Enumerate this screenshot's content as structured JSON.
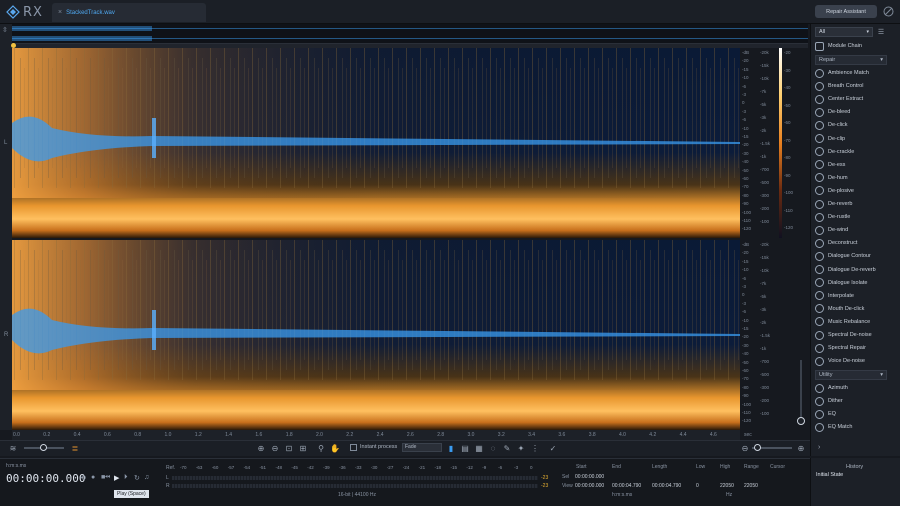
{
  "app": {
    "logo": "RX",
    "file_tab": "StackedTrack.wav",
    "repair_assistant": "Repair Assistant"
  },
  "channels": {
    "left": "L",
    "right": "R"
  },
  "spectrogram": {
    "db_scale": [
      "-dB",
      "-20",
      "-15",
      "-10",
      "-6",
      "-3",
      "0",
      "-3",
      "-6",
      "-10",
      "-15",
      "-20",
      "-30",
      "-40",
      "-50",
      "-60",
      "-70",
      "-80",
      "-90",
      "-100",
      "-110",
      "-120"
    ],
    "hz_scale": [
      "-20k",
      "-15k",
      "-10k",
      "-7k",
      "-5k",
      "-3k",
      "-2k",
      "-1.5k",
      "-1k",
      "-700",
      "-500",
      "-300",
      "-200",
      "-100"
    ],
    "colorbar": [
      "-20",
      "-30",
      "-40",
      "-50",
      "-60",
      "-70",
      "-80",
      "-90",
      "-100",
      "-110",
      "-120"
    ]
  },
  "timeline": {
    "labels": [
      "0.0",
      "0.2",
      "0.4",
      "0.6",
      "0.8",
      "1.0",
      "1.2",
      "1.4",
      "1.6",
      "1.8",
      "2.0",
      "2.2",
      "2.4",
      "2.6",
      "2.8",
      "3.0",
      "3.2",
      "3.4",
      "3.6",
      "3.8",
      "4.0",
      "4.2",
      "4.4",
      "4.6"
    ],
    "unit": "sec"
  },
  "toolbar": {
    "instant_process": "Instant process",
    "fade_mode": "Fade"
  },
  "panel": {
    "filter": "All",
    "module_chain": "Module Chain",
    "repair_section": "Repair",
    "utility_section": "Utility",
    "repair_modules": [
      "Ambience Match",
      "Breath Control",
      "Center Extract",
      "De-bleed",
      "De-click",
      "De-clip",
      "De-crackle",
      "De-ess",
      "De-hum",
      "De-plosive",
      "De-reverb",
      "De-rustle",
      "De-wind",
      "Deconstruct",
      "Dialogue Contour",
      "Dialogue De-reverb",
      "Dialogue Isolate",
      "Interpolate",
      "Mouth De-click",
      "Music Rebalance",
      "Spectral De-noise",
      "Spectral Repair",
      "Voice De-noise"
    ],
    "utility_modules": [
      "Azimuth",
      "Dither",
      "EQ",
      "EQ Match"
    ]
  },
  "transport": {
    "time_format": "h:m:s.ms",
    "time": "00:00:00.000",
    "tooltip": "Play (Space)",
    "meter_ref": "Ref.",
    "meter_scale": [
      "-70",
      "-63",
      "-60",
      "-57",
      "-54",
      "-51",
      "-48",
      "-45",
      "-42",
      "-39",
      "-36",
      "-33",
      "-30",
      "-27",
      "-24",
      "-21",
      "-18",
      "-15",
      "-12",
      "-9",
      "-6",
      "-3",
      "0"
    ],
    "meter_l": "L",
    "meter_r": "R",
    "peak_l": "-23",
    "peak_r": "-23",
    "format_info": "16-bit | 44100 Hz"
  },
  "selection": {
    "headers": {
      "start": "Start",
      "end": "End",
      "length": "Length",
      "low": "Low",
      "high": "High",
      "range": "Range",
      "cursor": "Cursor"
    },
    "sel_label": "Sel",
    "view_label": "View",
    "sel_start": "00:00:00.000",
    "view_start": "00:00:00.000",
    "view_end": "00:00:04.790",
    "view_length": "00:00:04.790",
    "low": "0",
    "high": "22050",
    "range": "22050",
    "time_unit": "h:m:s.ms",
    "freq_unit": "Hz"
  },
  "history": {
    "title": "History",
    "state": "Initial State"
  },
  "colors": {
    "accent": "#3a9bf0",
    "spec_warm": "#f0a040",
    "spec_cold": "#0a1a3a",
    "bg": "#16191f"
  }
}
